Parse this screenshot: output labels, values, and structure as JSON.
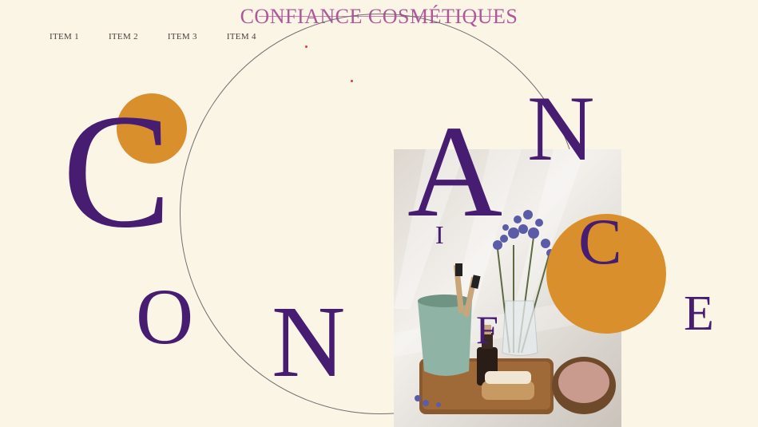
{
  "header": {
    "brand": "CONFIANCE COSMÉTIQUES"
  },
  "nav": {
    "items": [
      "ITEM 1",
      "ITEM 2",
      "ITEM 3",
      "ITEM 4"
    ]
  },
  "hero": {
    "letters": {
      "c1": "C",
      "o": "O",
      "n1": "N",
      "a": "A",
      "n2": "N",
      "i": "I",
      "c2": "C",
      "f": "F",
      "e": "E"
    },
    "colors": {
      "accent_orange": "#d98f2c",
      "purple": "#471d72",
      "brand_pink": "#b0579a",
      "background": "#fbf5e6"
    }
  },
  "image": {
    "subject": "bathroom still life with toothbrushes, dried lavender, oil bottle, brush and salt bowl"
  }
}
